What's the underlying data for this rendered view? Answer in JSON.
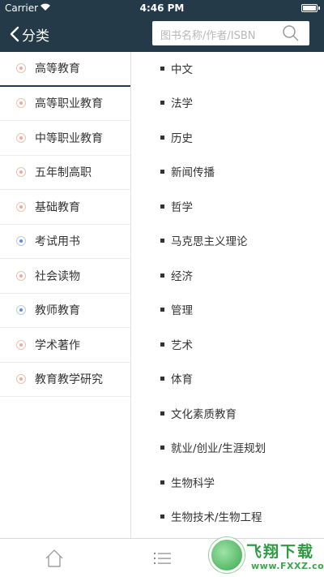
{
  "status_bar": {
    "carrier": "Carrier",
    "time": "4:46 PM"
  },
  "nav": {
    "back_label": "分类",
    "search_placeholder": "图书名称/作者/ISBN"
  },
  "categories": [
    {
      "label": "高等教育",
      "active": true
    },
    {
      "label": "高等职业教育",
      "active": false
    },
    {
      "label": "中等职业教育",
      "active": false
    },
    {
      "label": "五年制高职",
      "active": false
    },
    {
      "label": "基础教育",
      "active": false
    },
    {
      "label": "考试用书",
      "active": false
    },
    {
      "label": "社会读物",
      "active": false
    },
    {
      "label": "教师教育",
      "active": false
    },
    {
      "label": "学术著作",
      "active": false
    },
    {
      "label": "教育教学研究",
      "active": false
    }
  ],
  "subcategories": [
    "中文",
    "法学",
    "历史",
    "新闻传播",
    "哲学",
    "马克思主义理论",
    "经济",
    "管理",
    "艺术",
    "体育",
    "文化素质教育",
    "就业/创业/生涯规划",
    "生物科学",
    "生物技术/生物工程"
  ],
  "watermark": {
    "title": "飞翔下载",
    "url": "www.FXXZ.com"
  },
  "colors": {
    "nav_bg": "#243a48",
    "accent_green": "#2d9b43"
  }
}
